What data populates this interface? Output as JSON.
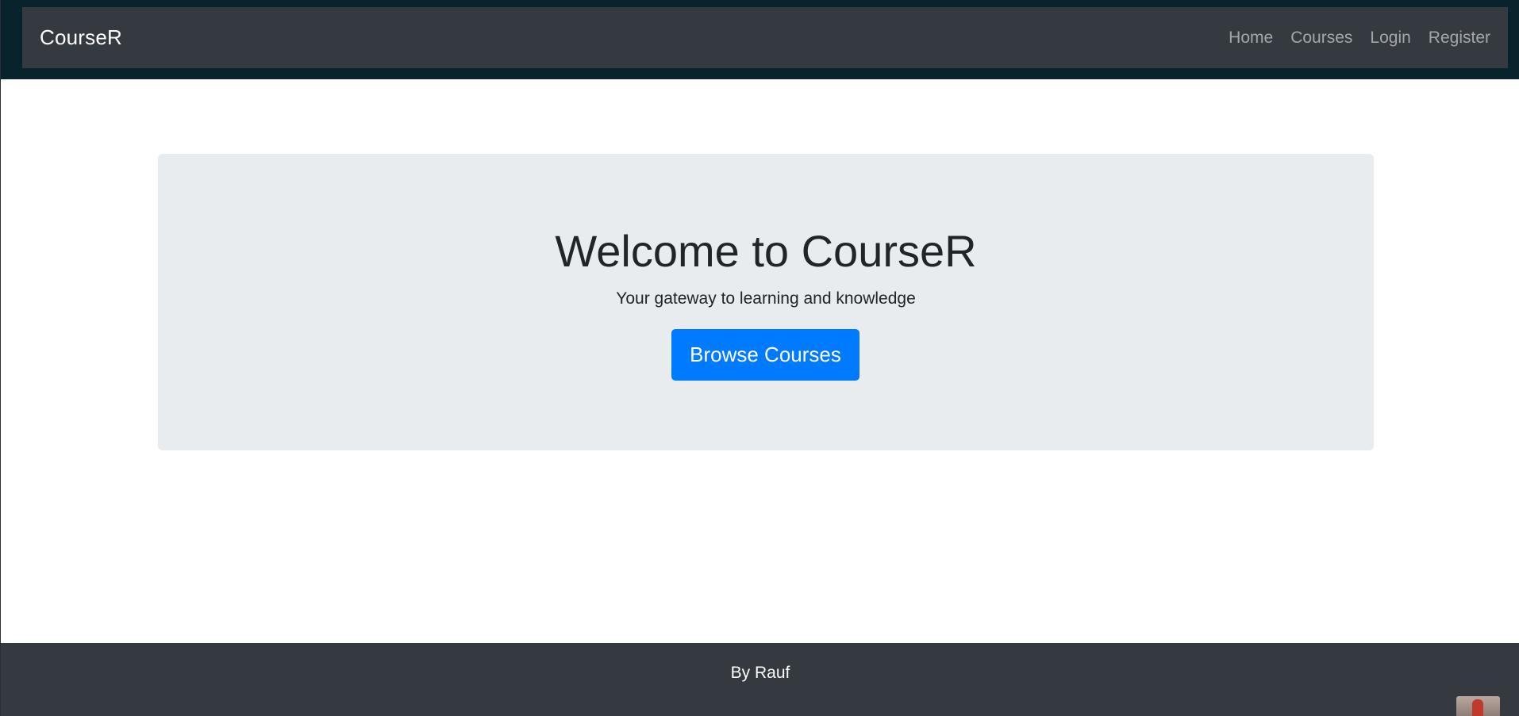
{
  "navbar": {
    "brand": "CourseR",
    "links": [
      {
        "label": "Home"
      },
      {
        "label": "Courses"
      },
      {
        "label": "Login"
      },
      {
        "label": "Register"
      }
    ]
  },
  "hero": {
    "title": "Welcome to CourseR",
    "subtitle": "Your gateway to learning and knowledge",
    "button_label": "Browse Courses"
  },
  "footer": {
    "text": "By Rauf"
  },
  "colors": {
    "navbar_bg": "#343a40",
    "frame_bg": "#08232c",
    "jumbotron_bg": "#e9ecef",
    "primary": "#007bff",
    "footer_bg": "#343a40"
  }
}
